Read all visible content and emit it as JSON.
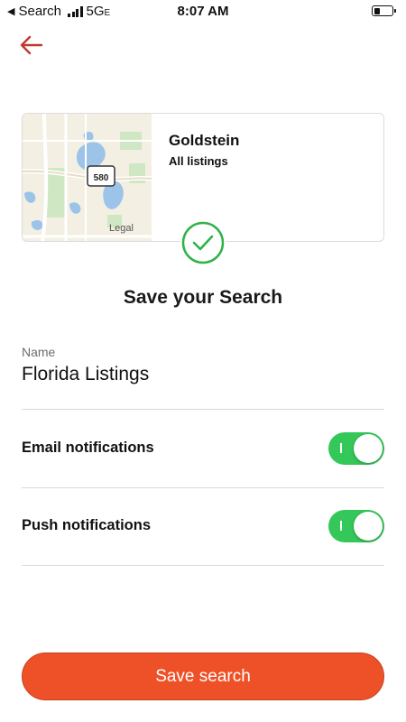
{
  "status_bar": {
    "back_app": "Search",
    "network": "5G",
    "network_suffix": "E",
    "time": "8:07 AM",
    "battery_level_percent": 30
  },
  "nav": {
    "back_icon": "arrow-left-icon",
    "accent": "#c0392b"
  },
  "card": {
    "title": "Goldstein",
    "subtitle": "All listings",
    "map_shield": "580",
    "map_legal": "Legal"
  },
  "heading": "Save your Search",
  "name_field": {
    "label": "Name",
    "value": "Florida Listings"
  },
  "settings": [
    {
      "label": "Email notifications",
      "enabled": true
    },
    {
      "label": "Push notifications",
      "enabled": true
    }
  ],
  "save_button": {
    "label": "Save search",
    "color": "#ee5127"
  },
  "colors": {
    "toggle_on": "#34c759",
    "check": "#2db34a"
  }
}
